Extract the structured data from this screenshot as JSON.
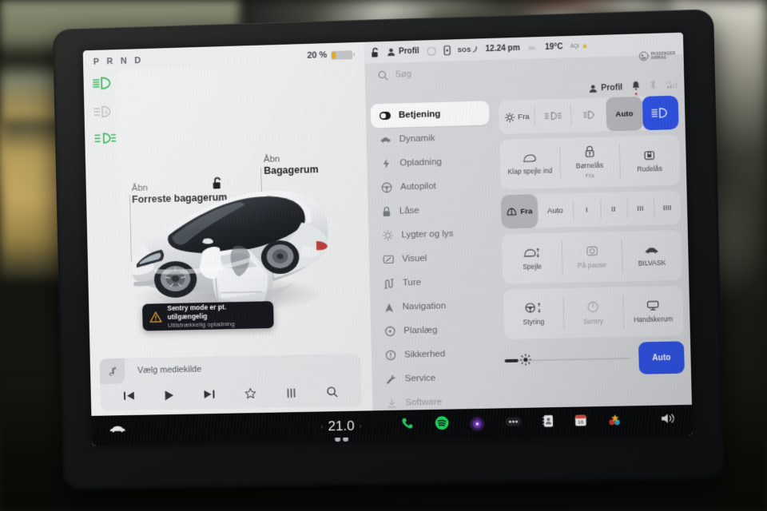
{
  "drive_view": {
    "gear_indicator": "P R N D",
    "battery": {
      "percent_label": "20 %",
      "fill_color": "#e8a626",
      "level": 20
    },
    "indicators": [
      {
        "name": "low-beam-indicator",
        "state": "on",
        "color": "#23b24b"
      },
      {
        "name": "auto-high-beam-indicator",
        "state": "off",
        "color": "#b9bcc0"
      },
      {
        "name": "fog-light-indicator",
        "state": "on",
        "color": "#23b24b"
      }
    ],
    "callouts": [
      {
        "action": "Åbn",
        "target": "Forreste bagagerum"
      },
      {
        "action": "Åbn",
        "target": "Bagagerum"
      }
    ],
    "notification": {
      "title": "Sentry mode er pt. utilgængelig",
      "subtitle": "Utilstrækkelig opladning"
    },
    "media": {
      "source_label": "Vælg mediekilde",
      "controls": [
        "previous",
        "play",
        "next",
        "favorite",
        "equalizer",
        "search"
      ]
    }
  },
  "status_bar": {
    "lock_state": "unlocked",
    "profile_label": "Profil",
    "sos_label": "SOS",
    "time": "12.24 pm",
    "temperature": "19°C",
    "aqi_label": "AQI",
    "airbag_line1": "PASSENGER",
    "airbag_line2": "AIRBAG"
  },
  "search": {
    "placeholder": "Søg"
  },
  "profile_row": {
    "label": "Profil"
  },
  "sidebar": {
    "items": [
      {
        "label": "Betjening",
        "icon": "toggle-icon",
        "selected": true
      },
      {
        "label": "Dynamik",
        "icon": "car-icon",
        "selected": false
      },
      {
        "label": "Opladning",
        "icon": "bolt-icon",
        "selected": false
      },
      {
        "label": "Autopilot",
        "icon": "steering-wheel-icon",
        "selected": false
      },
      {
        "label": "Låse",
        "icon": "lock-icon",
        "selected": false
      },
      {
        "label": "Lygter og lys",
        "icon": "sun-icon",
        "selected": false
      },
      {
        "label": "Visuel",
        "icon": "display-icon",
        "selected": false
      },
      {
        "label": "Ture",
        "icon": "road-icon",
        "selected": false
      },
      {
        "label": "Navigation",
        "icon": "navigation-arrow-icon",
        "selected": false
      },
      {
        "label": "Planlæg",
        "icon": "clock-icon",
        "selected": false
      },
      {
        "label": "Sikkerhed",
        "icon": "alert-circle-icon",
        "selected": false
      },
      {
        "label": "Service",
        "icon": "wrench-icon",
        "selected": false
      },
      {
        "label": "Software",
        "icon": "download-icon",
        "selected": false
      }
    ]
  },
  "controls": {
    "lights_row": [
      {
        "label": "Fra",
        "icon": "sun-icon",
        "state": "normal"
      },
      {
        "label": "",
        "icon": "fog-light-icon",
        "state": "normal"
      },
      {
        "label": "",
        "icon": "parking-light-icon",
        "state": "normal"
      },
      {
        "label": "Auto",
        "icon": "",
        "state": "selected"
      },
      {
        "label": "",
        "icon": "headlight-icon",
        "state": "accent"
      }
    ],
    "mirror_row": [
      {
        "label": "Klap spejle ind",
        "sub": "",
        "icon": "mirror-icon"
      },
      {
        "label": "Børnelås",
        "sub": "Fra",
        "icon": "child-lock-icon"
      },
      {
        "label": "Rudelås",
        "sub": "",
        "icon": "window-lock-icon"
      }
    ],
    "wiper_row": [
      {
        "label": "Fra",
        "icon": "wiper-icon",
        "state": "selected"
      },
      {
        "label": "Auto",
        "icon": "",
        "state": "normal"
      },
      {
        "label": "I",
        "icon": "",
        "state": "normal"
      },
      {
        "label": "II",
        "icon": "",
        "state": "normal"
      },
      {
        "label": "III",
        "icon": "",
        "state": "normal"
      },
      {
        "label": "IIII",
        "icon": "",
        "state": "normal"
      }
    ],
    "action_row_1": [
      {
        "label": "Spejle",
        "icon": "mirror-adjust-icon",
        "dim": false
      },
      {
        "label": "På pause",
        "icon": "camera-icon",
        "dim": true
      },
      {
        "label": "BILVASK",
        "icon": "car-wash-icon",
        "dim": false
      }
    ],
    "action_row_2": [
      {
        "label": "Styring",
        "icon": "steering-adjust-icon",
        "dim": false
      },
      {
        "label": "Sentry",
        "icon": "sentry-icon",
        "dim": true
      },
      {
        "label": "Handskerum",
        "icon": "glovebox-icon",
        "dim": false
      }
    ],
    "brightness": {
      "icon": "brightness-icon",
      "value": 8,
      "auto_label": "Auto",
      "accent_color": "#2f53e8"
    }
  },
  "dock": {
    "car_icon": "car-icon",
    "temperature": "21.0",
    "apps": [
      "phone-icon",
      "spotify-icon",
      "media-app-icon",
      "more-icon",
      "contacts-icon",
      "calendar-icon",
      "apps-grid-icon"
    ],
    "calendar_day": "16",
    "volume_icon": "volume-icon"
  }
}
